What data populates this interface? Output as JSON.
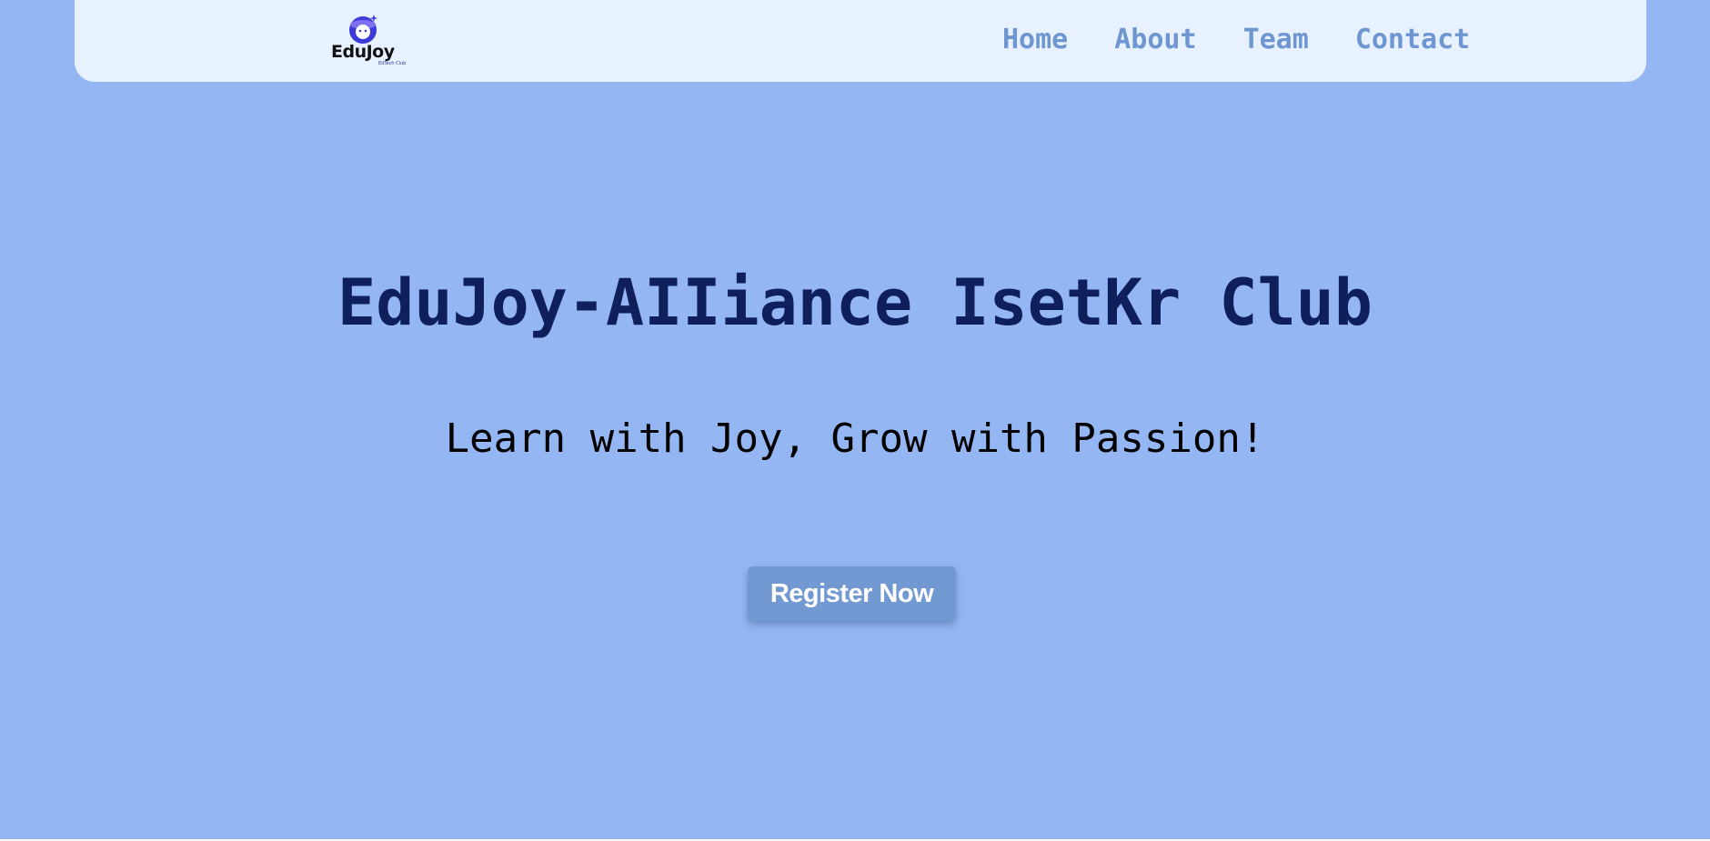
{
  "brand": {
    "name": "EduJoy",
    "tagline": "EdTech Club",
    "colors": {
      "background": "#94b6f3",
      "navbar": "#e8f1ff",
      "nav_link": "#6e96d0",
      "title": "#0e1f5c",
      "button": "#7299d2",
      "logo_mark": "#3d3bd8"
    }
  },
  "nav": {
    "links": [
      {
        "label": "Home"
      },
      {
        "label": "About"
      },
      {
        "label": "Team"
      },
      {
        "label": "Contact"
      }
    ]
  },
  "hero": {
    "title": "EduJoy-AIIiance IsetKr Club",
    "subtitle": "Learn with Joy, Grow with Passion!",
    "cta_label": "Register Now"
  },
  "icons": {
    "logo": "edujoy-logo-icon"
  }
}
